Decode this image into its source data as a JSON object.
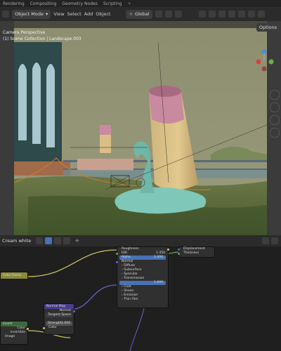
{
  "workspace_tabs": [
    "Rendering",
    "Compositing",
    "Geometry Nodes",
    "Scripting"
  ],
  "header": {
    "mode": "Object Mode",
    "menus": [
      "View",
      "Select",
      "Add",
      "Object"
    ],
    "transform_orientation": "Global",
    "options_label": "Options"
  },
  "viewport": {
    "camera_label": "Camera Perspective",
    "collection_label": "(1) Scene Collection | Landscape.003"
  },
  "node_editor": {
    "material_name": "Cream white",
    "nodes": {
      "bsdf": {
        "title": "Roughness",
        "rows": [
          "IOR",
          "Alpha",
          "Normal",
          "Diffuse",
          "Subsurface",
          "Specular",
          "Transmission",
          "Coat",
          "Sheen",
          "Emission",
          "Thin Film"
        ],
        "ior_value": "1.450",
        "alpha_value": "1.000",
        "weight_value": "1.000"
      },
      "output": {
        "title": "Displacement",
        "rows": [
          "Thickness"
        ]
      },
      "normal_map": {
        "title": "Normal Map",
        "output": "Normal",
        "space": "Tangent Space",
        "strength_label": "Strength",
        "strength_value": "1.000",
        "color_label": "Color"
      },
      "color_ramp": {
        "title": "Color Ramp"
      },
      "invert": {
        "title": "Invert",
        "rows": [
          "Color",
          "Invertible"
        ],
        "bottom": "Image"
      }
    }
  },
  "colors": {
    "accent": "#4772b3",
    "sky": "#8a8c6c",
    "ground": "#5a6a3a",
    "funnel_top": "#c98aa0",
    "funnel_body": "#d9bf85",
    "teal": "#7fc7b8"
  }
}
